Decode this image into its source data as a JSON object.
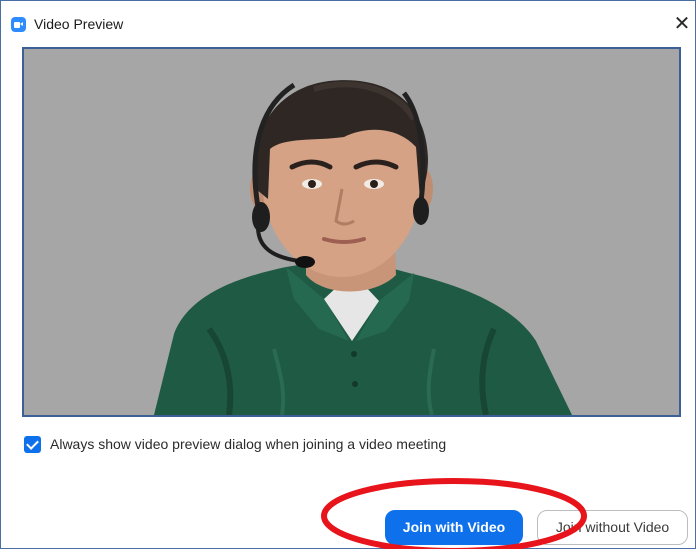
{
  "window": {
    "title": "Video Preview",
    "close_glyph": "✕"
  },
  "video": {
    "background_color": "#a6a6a6",
    "content": "webcam-preview-person-with-headset"
  },
  "preview_option": {
    "checked": true,
    "label": "Always show video preview dialog when joining a video meeting"
  },
  "buttons": {
    "join_with_video": "Join with Video",
    "join_without_video": "Join without Video"
  },
  "colors": {
    "accent": "#0e71eb",
    "annotation_circle": "#e8141b",
    "frame_border": "#3d5f97"
  },
  "icons": {
    "app": "zoom-camera-icon",
    "close": "close-icon",
    "check": "checkmark-icon"
  }
}
